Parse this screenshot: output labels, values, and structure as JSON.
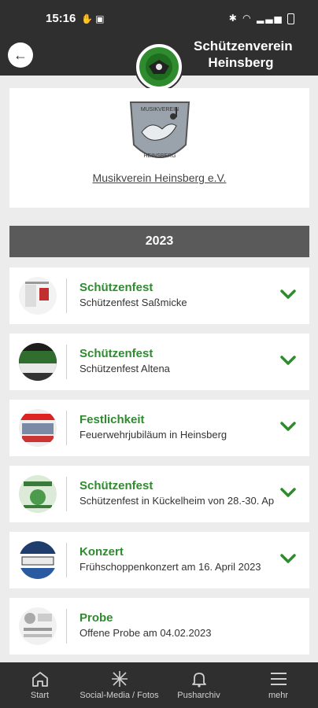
{
  "status_bar": {
    "time": "15:16"
  },
  "header": {
    "title_line1": "Schützenverein",
    "title_line2": "Heinsberg"
  },
  "org": {
    "name": "Musikverein Heinsberg e.V.",
    "logo_text_top": "MUSIKVEREIN",
    "logo_text_bottom": "HEINSBERG"
  },
  "year_label": "2023",
  "events": [
    {
      "title": "Schützenfest",
      "subtitle": "Schützenfest Saßmicke"
    },
    {
      "title": "Schützenfest",
      "subtitle": "Schützenfest Altena"
    },
    {
      "title": "Festlichkeit",
      "subtitle": "Feuerwehrjubiläum in Heinsberg"
    },
    {
      "title": "Schützenfest",
      "subtitle": "Schützenfest in Kückelheim von 28.-30. Ap"
    },
    {
      "title": "Konzert",
      "subtitle": "Frühschoppenkonzert am 16. April 2023"
    },
    {
      "title": "Probe",
      "subtitle": "Offene Probe am 04.02.2023"
    }
  ],
  "bottom_nav": [
    {
      "label": "Start",
      "icon": "home-icon"
    },
    {
      "label": "Social-Media / Fotos",
      "icon": "social-icon"
    },
    {
      "label": "Pusharchiv",
      "icon": "bell-icon"
    },
    {
      "label": "mehr",
      "icon": "menu-icon"
    }
  ],
  "colors": {
    "header_bg": "#2f2f2f",
    "accent_green": "#2e8b2e",
    "year_bar": "#5a5a5a"
  }
}
